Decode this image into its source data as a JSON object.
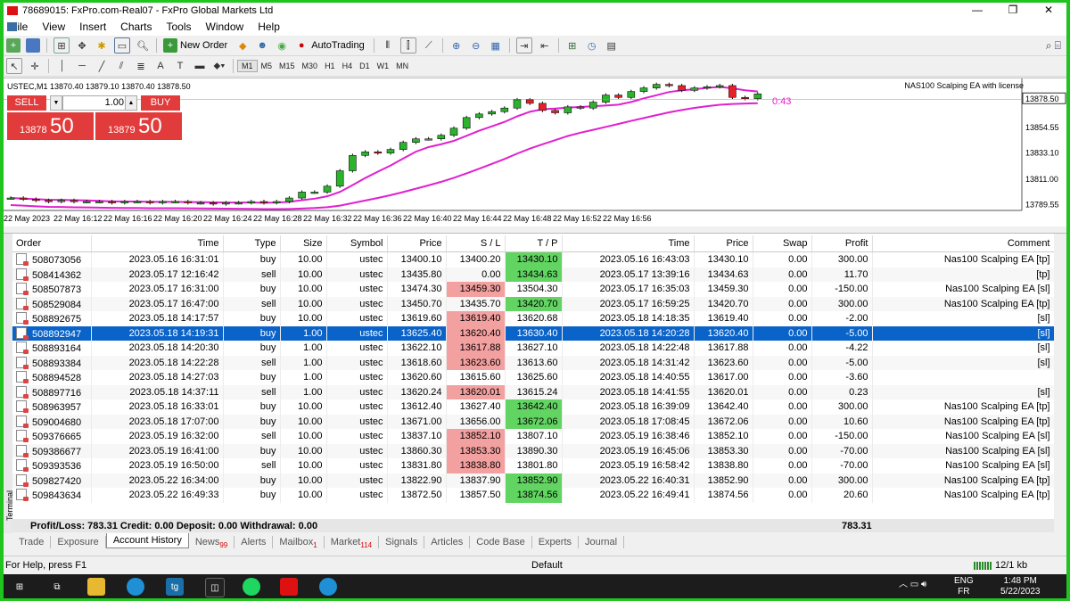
{
  "window": {
    "title": "78689015: FxPro.com-Real07 - FxPro Global Markets Ltd"
  },
  "menu": [
    "File",
    "View",
    "Insert",
    "Charts",
    "Tools",
    "Window",
    "Help"
  ],
  "toolbar": {
    "new_order": "New Order",
    "autotrading": "AutoTrading"
  },
  "timeframes": [
    "M1",
    "M5",
    "M15",
    "M30",
    "H1",
    "H4",
    "D1",
    "W1",
    "MN"
  ],
  "chart": {
    "ohlc": "USTEC,M1  13870.40 13879.10 13870.40 13878.50",
    "ea_name": "NAS100 Scalping EA with license",
    "timer": "0:43",
    "sell_label": "SELL",
    "buy_label": "BUY",
    "lot": "1.00",
    "sell_small": "13878",
    "sell_big": "50",
    "buy_small": "13879",
    "buy_big": "50",
    "price_labels": [
      "13878.50",
      "13854.55",
      "13833.10",
      "13811.00",
      "13789.55"
    ],
    "time_labels": [
      "22 May 2023",
      "22 May 16:12",
      "22 May 16:16",
      "22 May 16:20",
      "22 May 16:24",
      "22 May 16:28",
      "22 May 16:32",
      "22 May 16:36",
      "22 May 16:40",
      "22 May 16:44",
      "22 May 16:48",
      "22 May 16:52",
      "22 May 16:56"
    ]
  },
  "chart_data": {
    "type": "candlestick",
    "close": [
      13795,
      13794,
      13793,
      13792,
      13793,
      13792,
      13792,
      13792,
      13791,
      13792,
      13792,
      13791,
      13792,
      13792,
      13791,
      13791,
      13790,
      13791,
      13791,
      13792,
      13791,
      13792,
      13795,
      13800,
      13800,
      13805,
      13818,
      13831,
      13834,
      13833,
      13836,
      13842,
      13845,
      13845,
      13848,
      13854,
      13863,
      13866,
      13868,
      13871,
      13878,
      13875,
      13869,
      13867,
      13872,
      13871,
      13876,
      13882,
      13880,
      13885,
      13888,
      13891,
      13890,
      13886,
      13888,
      13889,
      13890,
      13880,
      13879,
      13883
    ]
  },
  "orders": {
    "columns": [
      "Order",
      "Time",
      "Type",
      "Size",
      "Symbol",
      "Price",
      "S / L",
      "T / P",
      "Time",
      "Price",
      "Swap",
      "Profit",
      "Comment"
    ],
    "rows": [
      [
        "508073056",
        "2023.05.16 16:31:01",
        "buy",
        "10.00",
        "ustec",
        "13400.10",
        "13400.20",
        "13430.10",
        "2023.05.16 16:43:03",
        "13430.10",
        "0.00",
        "300.00",
        "Nas100 Scalping EA [tp]"
      ],
      [
        "508414362",
        "2023.05.17 12:16:42",
        "sell",
        "10.00",
        "ustec",
        "13435.80",
        "0.00",
        "13434.63",
        "2023.05.17 13:39:16",
        "13434.63",
        "0.00",
        "11.70",
        "[tp]"
      ],
      [
        "508507873",
        "2023.05.17 16:31:00",
        "buy",
        "10.00",
        "ustec",
        "13474.30",
        "13459.30",
        "13504.30",
        "2023.05.17 16:35:03",
        "13459.30",
        "0.00",
        "-150.00",
        "Nas100 Scalping EA [sl]"
      ],
      [
        "508529084",
        "2023.05.17 16:47:00",
        "sell",
        "10.00",
        "ustec",
        "13450.70",
        "13435.70",
        "13420.70",
        "2023.05.17 16:59:25",
        "13420.70",
        "0.00",
        "300.00",
        "Nas100 Scalping EA [tp]"
      ],
      [
        "508892675",
        "2023.05.18 14:17:57",
        "buy",
        "10.00",
        "ustec",
        "13619.60",
        "13619.40",
        "13620.68",
        "2023.05.18 14:18:35",
        "13619.40",
        "0.00",
        "-2.00",
        "[sl]"
      ],
      [
        "508892947",
        "2023.05.18 14:19:31",
        "buy",
        "1.00",
        "ustec",
        "13625.40",
        "13620.40",
        "13630.40",
        "2023.05.18 14:20:28",
        "13620.40",
        "0.00",
        "-5.00",
        "[sl]"
      ],
      [
        "508893164",
        "2023.05.18 14:20:30",
        "buy",
        "1.00",
        "ustec",
        "13622.10",
        "13617.88",
        "13627.10",
        "2023.05.18 14:22:48",
        "13617.88",
        "0.00",
        "-4.22",
        "[sl]"
      ],
      [
        "508893384",
        "2023.05.18 14:22:28",
        "sell",
        "1.00",
        "ustec",
        "13618.60",
        "13623.60",
        "13613.60",
        "2023.05.18 14:31:42",
        "13623.60",
        "0.00",
        "-5.00",
        "[sl]"
      ],
      [
        "508894528",
        "2023.05.18 14:27:03",
        "buy",
        "1.00",
        "ustec",
        "13620.60",
        "13615.60",
        "13625.60",
        "2023.05.18 14:40:55",
        "13617.00",
        "0.00",
        "-3.60",
        ""
      ],
      [
        "508897716",
        "2023.05.18 14:37:11",
        "sell",
        "1.00",
        "ustec",
        "13620.24",
        "13620.01",
        "13615.24",
        "2023.05.18 14:41:55",
        "13620.01",
        "0.00",
        "0.23",
        "[sl]"
      ],
      [
        "508963957",
        "2023.05.18 16:33:01",
        "buy",
        "10.00",
        "ustec",
        "13612.40",
        "13627.40",
        "13642.40",
        "2023.05.18 16:39:09",
        "13642.40",
        "0.00",
        "300.00",
        "Nas100 Scalping EA [tp]"
      ],
      [
        "509004680",
        "2023.05.18 17:07:00",
        "buy",
        "10.00",
        "ustec",
        "13671.00",
        "13656.00",
        "13672.06",
        "2023.05.18 17:08:45",
        "13672.06",
        "0.00",
        "10.60",
        "Nas100 Scalping EA [tp]"
      ],
      [
        "509376665",
        "2023.05.19 16:32:00",
        "sell",
        "10.00",
        "ustec",
        "13837.10",
        "13852.10",
        "13807.10",
        "2023.05.19 16:38:46",
        "13852.10",
        "0.00",
        "-150.00",
        "Nas100 Scalping EA [sl]"
      ],
      [
        "509386677",
        "2023.05.19 16:41:00",
        "buy",
        "10.00",
        "ustec",
        "13860.30",
        "13853.30",
        "13890.30",
        "2023.05.19 16:45:06",
        "13853.30",
        "0.00",
        "-70.00",
        "Nas100 Scalping EA [sl]"
      ],
      [
        "509393536",
        "2023.05.19 16:50:00",
        "sell",
        "10.00",
        "ustec",
        "13831.80",
        "13838.80",
        "13801.80",
        "2023.05.19 16:58:42",
        "13838.80",
        "0.00",
        "-70.00",
        "Nas100 Scalping EA [sl]"
      ],
      [
        "509827420",
        "2023.05.22 16:34:00",
        "buy",
        "10.00",
        "ustec",
        "13822.90",
        "13837.90",
        "13852.90",
        "2023.05.22 16:40:31",
        "13852.90",
        "0.00",
        "300.00",
        "Nas100 Scalping EA [tp]"
      ],
      [
        "509843634",
        "2023.05.22 16:49:33",
        "buy",
        "10.00",
        "ustec",
        "13872.50",
        "13857.50",
        "13874.56",
        "2023.05.22 16:49:41",
        "13874.56",
        "0.00",
        "20.60",
        "Nas100 Scalping EA [tp]"
      ]
    ],
    "sl_hit": [
      0,
      0,
      1,
      0,
      1,
      1,
      1,
      1,
      0,
      1,
      0,
      0,
      1,
      1,
      1,
      0,
      0
    ],
    "tp_hit": [
      1,
      1,
      0,
      1,
      0,
      0,
      0,
      0,
      0,
      0,
      1,
      1,
      0,
      0,
      0,
      1,
      1
    ],
    "selected_index": 5
  },
  "summary": {
    "text": "Profit/Loss: 783.31  Credit: 0.00  Deposit: 0.00  Withdrawal: 0.00",
    "total": "783.31"
  },
  "tabs": [
    {
      "label": "Trade",
      "badge": ""
    },
    {
      "label": "Exposure",
      "badge": ""
    },
    {
      "label": "Account History",
      "badge": "",
      "active": true
    },
    {
      "label": "News",
      "badge": "99"
    },
    {
      "label": "Alerts",
      "badge": ""
    },
    {
      "label": "Mailbox",
      "badge": "1"
    },
    {
      "label": "Market",
      "badge": "114"
    },
    {
      "label": "Signals",
      "badge": ""
    },
    {
      "label": "Articles",
      "badge": ""
    },
    {
      "label": "Code Base",
      "badge": ""
    },
    {
      "label": "Experts",
      "badge": ""
    },
    {
      "label": "Journal",
      "badge": ""
    }
  ],
  "terminal_label": "Terminal",
  "status": {
    "help": "For Help, press F1",
    "profile": "Default",
    "kb": "12/1 kb"
  },
  "taskbar": {
    "lang1": "ENG",
    "lang2": "FR",
    "time": "1:48 PM",
    "date": "5/22/2023"
  },
  "colors": {
    "bull": "#2bb32b",
    "bear": "#e8202a",
    "ma": "#e020d0",
    "selected": "#0a63c8",
    "sl_cell": "#f3a0a0",
    "tp_cell": "#62d462"
  }
}
